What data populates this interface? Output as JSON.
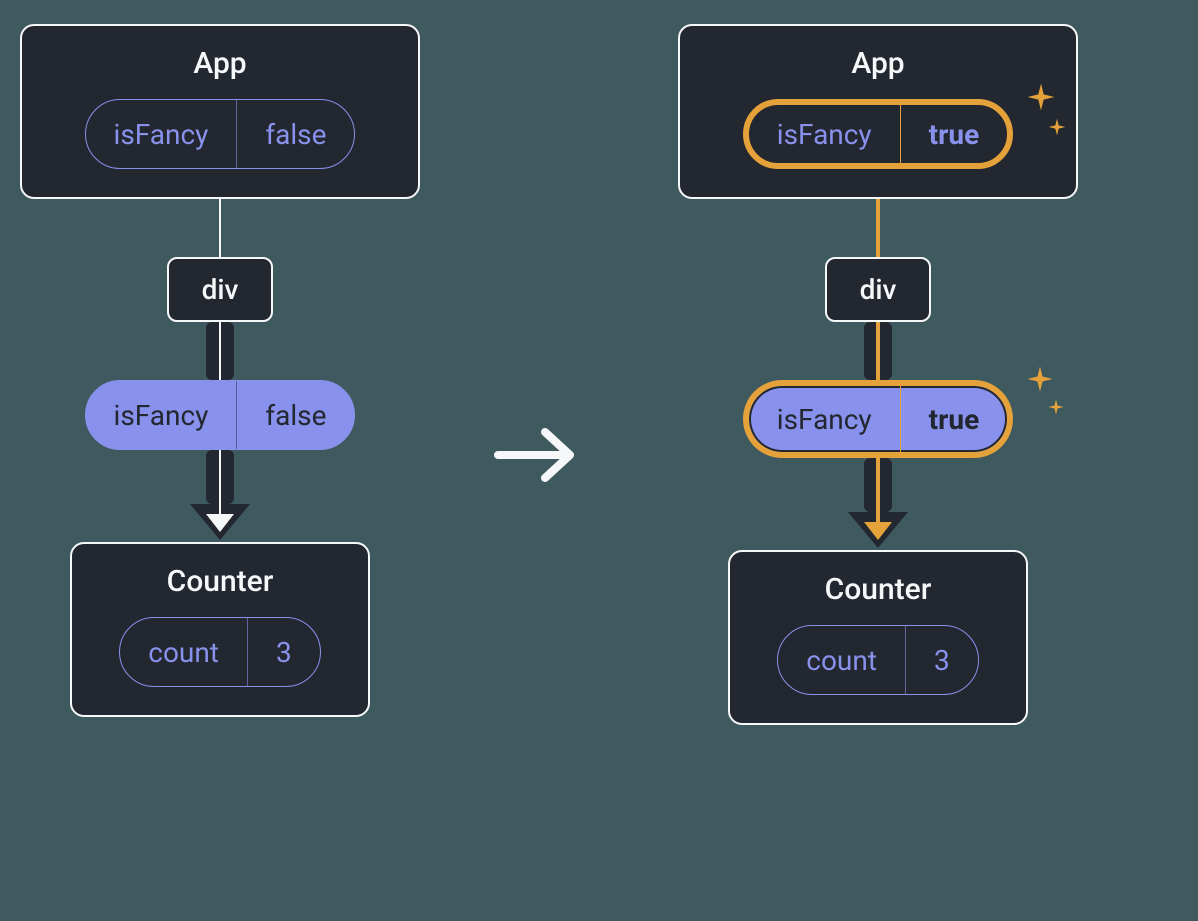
{
  "left": {
    "app": {
      "title": "App",
      "prop": {
        "name": "isFancy",
        "value": "false"
      }
    },
    "mid": {
      "label": "div"
    },
    "propPill": {
      "name": "isFancy",
      "value": "false"
    },
    "counter": {
      "title": "Counter",
      "prop": {
        "name": "count",
        "value": "3"
      }
    }
  },
  "right": {
    "app": {
      "title": "App",
      "prop": {
        "name": "isFancy",
        "value": "true"
      }
    },
    "mid": {
      "label": "div"
    },
    "propPill": {
      "name": "isFancy",
      "value": "true"
    },
    "counter": {
      "title": "Counter",
      "prop": {
        "name": "count",
        "value": "3"
      }
    }
  },
  "colors": {
    "bg": "#3f5a5f",
    "node": "#23272f",
    "outline": "#f6f7f9",
    "accent": "#8891ec",
    "highlight": "#e5a13a"
  }
}
